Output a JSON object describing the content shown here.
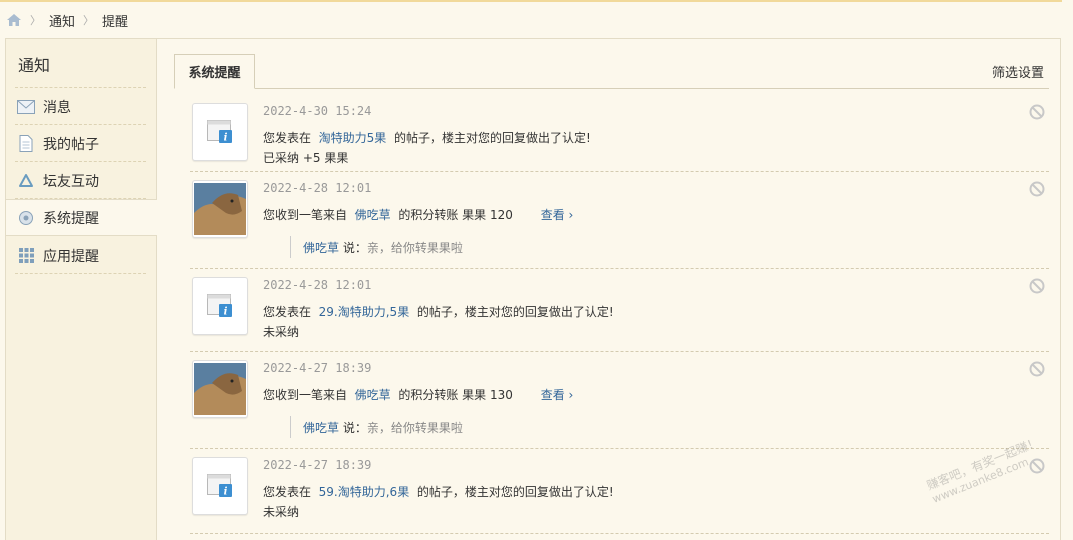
{
  "breadcrumb": {
    "home_icon": "home-icon",
    "items": [
      "通知",
      "提醒"
    ]
  },
  "sidebar": {
    "title": "通知",
    "items": [
      {
        "label": "消息",
        "icon": "envelope-icon",
        "active": false
      },
      {
        "label": "我的帖子",
        "icon": "document-icon",
        "active": false
      },
      {
        "label": "坛友互动",
        "icon": "recycle-icon",
        "active": false
      },
      {
        "label": "系统提醒",
        "icon": "gear-icon",
        "active": true
      },
      {
        "label": "应用提醒",
        "icon": "grid-icon",
        "active": false
      }
    ]
  },
  "main": {
    "tab_label": "系统提醒",
    "filter_label": "筛选设置",
    "notices": [
      {
        "type": "system",
        "time": "2022-4-30 15:24",
        "pre": "您发表在",
        "link": "淘特助力5果",
        "post": "的帖子，楼主对您的回复做出了认定!",
        "line2": "已采纳 +5 果果"
      },
      {
        "type": "transfer",
        "time": "2022-4-28 12:01",
        "pre": "您收到一笔来自",
        "link": "佛吃草",
        "post": "的积分转账 果果 120",
        "view": "查看 ›",
        "quote_user": "佛吃草",
        "quote_said": "说：",
        "quote_text": "亲，给你转果果啦"
      },
      {
        "type": "system",
        "time": "2022-4-28 12:01",
        "pre": "您发表在",
        "link": "29.淘特助力,5果",
        "post": "的帖子，楼主对您的回复做出了认定!",
        "line2": "未采纳"
      },
      {
        "type": "transfer",
        "time": "2022-4-27 18:39",
        "pre": "您收到一笔来自",
        "link": "佛吃草",
        "post": "的积分转账 果果 130",
        "view": "查看 ›",
        "quote_user": "佛吃草",
        "quote_said": "说：",
        "quote_text": "亲，给你转果果啦"
      },
      {
        "type": "system",
        "time": "2022-4-27 18:39",
        "pre": "您发表在",
        "link": "59.淘特助力,6果",
        "post": "的帖子，楼主对您的回复做出了认定!",
        "line2": "未采纳"
      }
    ]
  },
  "watermark": {
    "line1": "赚客吧，有奖一起赚！",
    "line2": "www.zuanke8.com"
  },
  "colors": {
    "link": "#336699",
    "background": "#fcf8ec",
    "sidebar": "#f8f2df"
  }
}
